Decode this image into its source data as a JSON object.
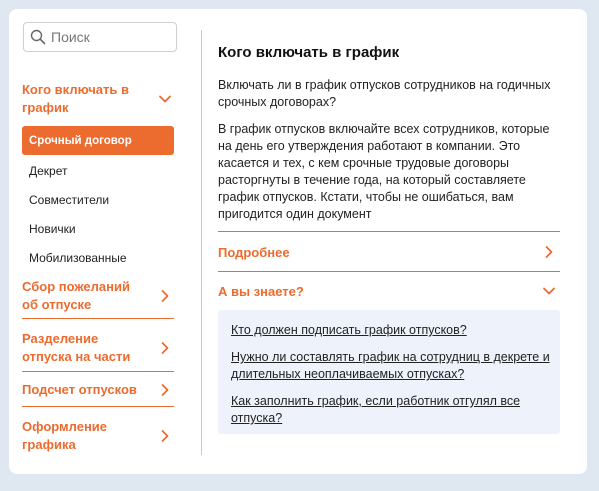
{
  "search": {
    "placeholder": "Поиск",
    "icon": "search-icon"
  },
  "sidebar": {
    "sections": [
      {
        "label": "Кого включать в график",
        "expanded": true
      },
      {
        "label": "Сбор пожеланий об отпуске",
        "expanded": false
      },
      {
        "label": "Разделение отпуска на части",
        "expanded": false
      },
      {
        "label": "Подсчет отпусков",
        "expanded": false
      },
      {
        "label": "Оформление графика",
        "expanded": false
      }
    ],
    "subitems": [
      {
        "label": "Срочный договор",
        "active": true
      },
      {
        "label": "Декрет",
        "active": false
      },
      {
        "label": "Совместители",
        "active": false
      },
      {
        "label": "Новички",
        "active": false
      },
      {
        "label": "Мобилизованные",
        "active": false
      }
    ]
  },
  "main": {
    "title": "Кого включать в график",
    "question": "Включать ли в график отпусков сотрудников на годичных срочных договорах?",
    "answer": "В график отпусков включайте всех сотрудников, которые на день его утверждения работают в компании. Это касается и тех, с кем срочные трудовые договоры расторгнуты в течение года, на который составляете график отпусков. Кстати, чтобы не ошибаться, вам пригодится один документ",
    "accordion": [
      {
        "label": "Подробнее",
        "expanded": false
      },
      {
        "label": "А вы знаете?",
        "expanded": true
      }
    ],
    "links": [
      "Кто должен подписать график отпусков?",
      "Нужно ли составлять график на сотрудниц в декрете и длительных неоплачиваемых отпусках?",
      "Как заполнить график, если работник отгулял все отпуска?"
    ]
  },
  "colors": {
    "accent": "#ec6b2f",
    "background": "#dfe7f1",
    "info_box": "#eef3fb"
  }
}
